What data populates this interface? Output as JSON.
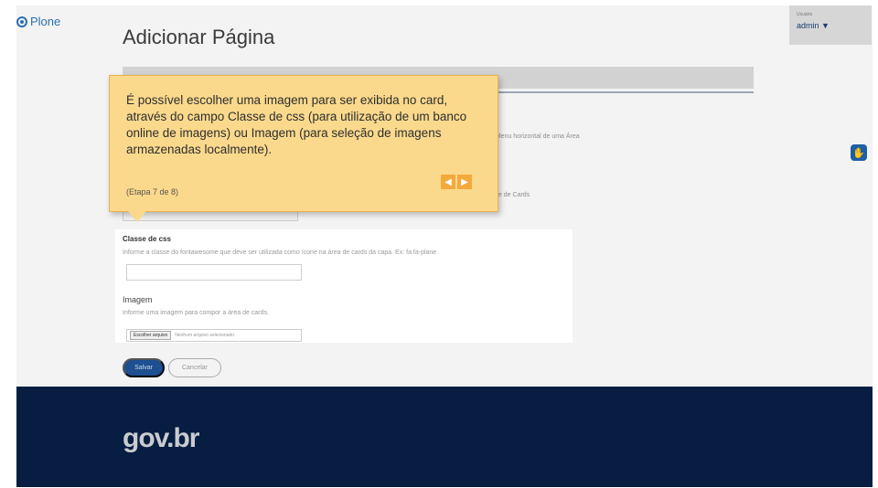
{
  "brand": {
    "logo_text": "Plone",
    "gov_logo": "gov.br"
  },
  "page": {
    "title": "Adicionar Página"
  },
  "user": {
    "caption": "Usuário",
    "name": "admin ▼"
  },
  "background_hints": {
    "side_text_1": "o Menu horizontal de uma Área",
    "side_text_2": "ilate de Cards"
  },
  "form": {
    "css_class": {
      "label": "Classe de css",
      "help": "Informe a classe do fontawesome que deve ser utilizada como ícone na área de cards da capa. Ex: fa fa-plane",
      "value": ""
    },
    "image": {
      "label": "Imagem",
      "help": "Informe uma imagem para compor a área de cards.",
      "button_label": "Escolher arquivo",
      "file_status": "Nenhum arquivo selecionado"
    },
    "save_label": "Salvar",
    "cancel_label": "Cancelar"
  },
  "tour": {
    "text": "É possível escolher uma imagem para ser exibida no card, através do campo Classe de css (para utilização de um banco online de imagens) ou Imagem (para seleção de imagens armazenadas localmente).",
    "step": "(Etapa 7 de 8)",
    "prev_icon": "chevron-left-icon",
    "next_icon": "chevron-right-icon"
  },
  "colors": {
    "tour_bg": "#fbd98c",
    "tour_nav": "#f4a93b",
    "footer_bg": "#071d41",
    "primary": "#1d4f91"
  }
}
